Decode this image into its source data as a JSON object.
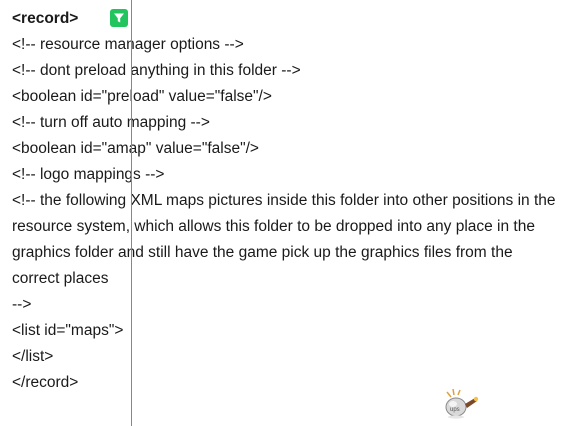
{
  "document": {
    "lines": [
      "<record>",
      "<!-- resource manager options -->",
      "<!-- dont preload anything in this folder -->",
      "<boolean id=\"preload\" value=\"false\"/>",
      "<!-- turn off auto mapping -->",
      "<boolean id=\"amap\" value=\"false\"/>",
      "<!-- logo mappings -->",
      "<!-- the following XML maps pictures inside this folder into other positions in the resource system, which allows this folder to be dropped into any place in the graphics folder and still have the game pick up the graphics files from the correct places",
      "-->",
      "<list id=\"maps\">",
      "</list>",
      "</record>"
    ]
  },
  "toolbar": {
    "filter_icon": "filter-icon",
    "filter_color": "#21c45d"
  },
  "guide": {
    "color": "#33b86b"
  },
  "mascot": {
    "icon": "ups-mascot-icon"
  }
}
